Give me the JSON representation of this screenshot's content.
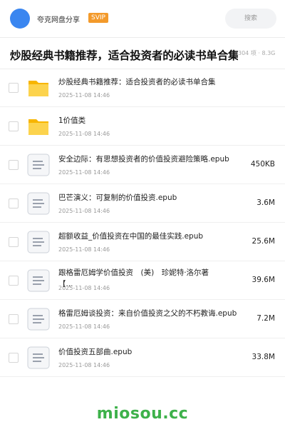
{
  "header": {
    "app_name": "夸克网盘分享",
    "badge": "SVIP",
    "search_placeholder": "搜索"
  },
  "page": {
    "title": "炒股经典书籍推荐，适合投资者的必读书单合集",
    "meta": "304 项 · 8.3G"
  },
  "files": [
    {
      "name": "炒股经典书籍推荐：适合投资者的必读书单合集",
      "date": "2025-11-08 14:46",
      "size": "",
      "type": "folder-icon"
    },
    {
      "name": "1价值类",
      "date": "2025-11-08 14:46",
      "size": "",
      "type": "folder-icon"
    },
    {
      "name": "安全边际：有思想投资者的价值投资避险策略.epub",
      "date": "2025-11-08 14:46",
      "size": "450KB",
      "type": "file-icon"
    },
    {
      "name": "巴芒演义：可复制的价值投资.epub",
      "date": "2025-11-08 14:46",
      "size": "3.6M",
      "type": "file-icon"
    },
    {
      "name": "超额收益_价值投资在中国的最佳实践.epub",
      "date": "2025-11-08 14:46",
      "size": "25.6M",
      "type": "file-icon"
    },
    {
      "name": "跟格雷厄姆学价值投资　(美)　珍妮特·洛尔著【...",
      "date": "2025-11-08 14:46",
      "size": "39.6M",
      "type": "file-icon"
    },
    {
      "name": "格雷厄姆谈投资：来自价值投资之父的不朽教诲.epub",
      "date": "2025-11-08 14:46",
      "size": "7.2M",
      "type": "file-icon"
    },
    {
      "name": "价值投资五部曲.epub",
      "date": "2025-11-08 14:46",
      "size": "33.8M",
      "type": "file-icon"
    }
  ],
  "footer": {
    "watermark": "miosou.cc"
  },
  "colors": {
    "accent": "#3a86f0",
    "svip": "#f39a2b",
    "folder": "#f9c623",
    "watermark": "#3db14a"
  }
}
